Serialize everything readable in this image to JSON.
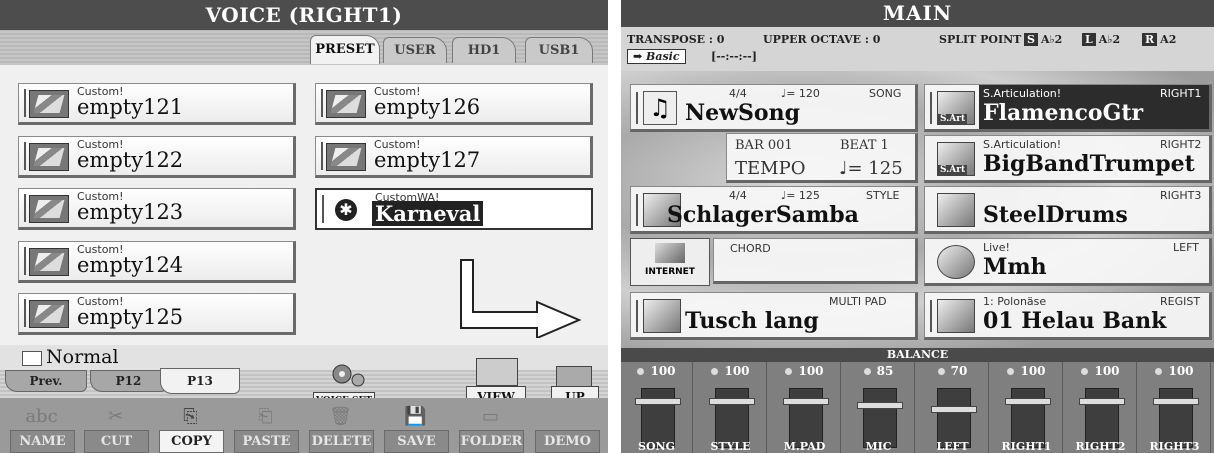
{
  "left": {
    "title": "VOICE (RIGHT1)",
    "tabs": [
      "PRESET",
      "USER",
      "HD1",
      "USB1"
    ],
    "voices": [
      {
        "category": "Custom!",
        "name": "empty121"
      },
      {
        "category": "Custom!",
        "name": "empty122"
      },
      {
        "category": "Custom!",
        "name": "empty123"
      },
      {
        "category": "Custom!",
        "name": "empty124"
      },
      {
        "category": "Custom!",
        "name": "empty125"
      },
      {
        "category": "Custom!",
        "name": "empty126"
      },
      {
        "category": "Custom!",
        "name": "empty127"
      },
      {
        "category": "CustomWA!",
        "name": "Karneval"
      }
    ],
    "folder": "Normal",
    "pages": [
      "Prev.",
      "P12",
      "P13"
    ],
    "voice_set": "VOICE SET",
    "view": "VIEW",
    "up": "UP",
    "buttons": [
      "NAME",
      "CUT",
      "COPY",
      "PASTE",
      "DELETE",
      "SAVE",
      "FOLDER",
      "DEMO"
    ]
  },
  "right": {
    "title": "MAIN",
    "transpose": "TRANSPOSE : 0",
    "upper_octave": "UPPER OCTAVE : 0",
    "split_point": "SPLIT POINT",
    "split_s": "S",
    "split_s_val": "A♭2",
    "split_l": "L",
    "split_l_val": "A♭2",
    "split_r": "R",
    "split_r_val": "A2",
    "mode": "Basic",
    "time": "[--:--:--]",
    "song": {
      "meter": "4/4",
      "tempo": "♩= 120",
      "label": "SONG",
      "name": "NewSong"
    },
    "bar": {
      "bar_label": "BAR 001",
      "beat_label": "BEAT  1",
      "tempo_label": "TEMPO",
      "tempo_value": "♩= 125"
    },
    "style": {
      "meter": "4/4",
      "tempo": "♩= 125",
      "label": "STYLE",
      "name": "SchlagerSamba"
    },
    "chord": {
      "label": "CHORD",
      "internet": "INTERNET"
    },
    "multipad": {
      "label": "MULTI PAD",
      "name": "Tusch lang"
    },
    "right1": {
      "category": "S.Articulation!",
      "part": "RIGHT1",
      "name": "FlamencoGtr",
      "badge": "S.Art"
    },
    "right2": {
      "category": "S.Articulation!",
      "part": "RIGHT2",
      "name": "BigBandTrumpet",
      "badge": "S.Art"
    },
    "right3": {
      "category": "",
      "part": "RIGHT3",
      "name": "SteelDrums"
    },
    "left_part": {
      "category": "Live!",
      "part": "LEFT",
      "name": "Mmh"
    },
    "regist": {
      "category": "1: Polonäse",
      "part": "REGIST",
      "name": "01 Helau Bank"
    },
    "balance_title": "BALANCE",
    "balance": [
      {
        "value": "100",
        "label": "SONG",
        "level": 100
      },
      {
        "value": "100",
        "label": "STYLE",
        "level": 100
      },
      {
        "value": "100",
        "label": "M.PAD",
        "level": 100
      },
      {
        "value": "85",
        "label": "MIC",
        "level": 85
      },
      {
        "value": "70",
        "label": "LEFT",
        "level": 70
      },
      {
        "value": "100",
        "label": "RIGHT1",
        "level": 100
      },
      {
        "value": "100",
        "label": "RIGHT2",
        "level": 100
      },
      {
        "value": "100",
        "label": "RIGHT3",
        "level": 100
      }
    ]
  }
}
